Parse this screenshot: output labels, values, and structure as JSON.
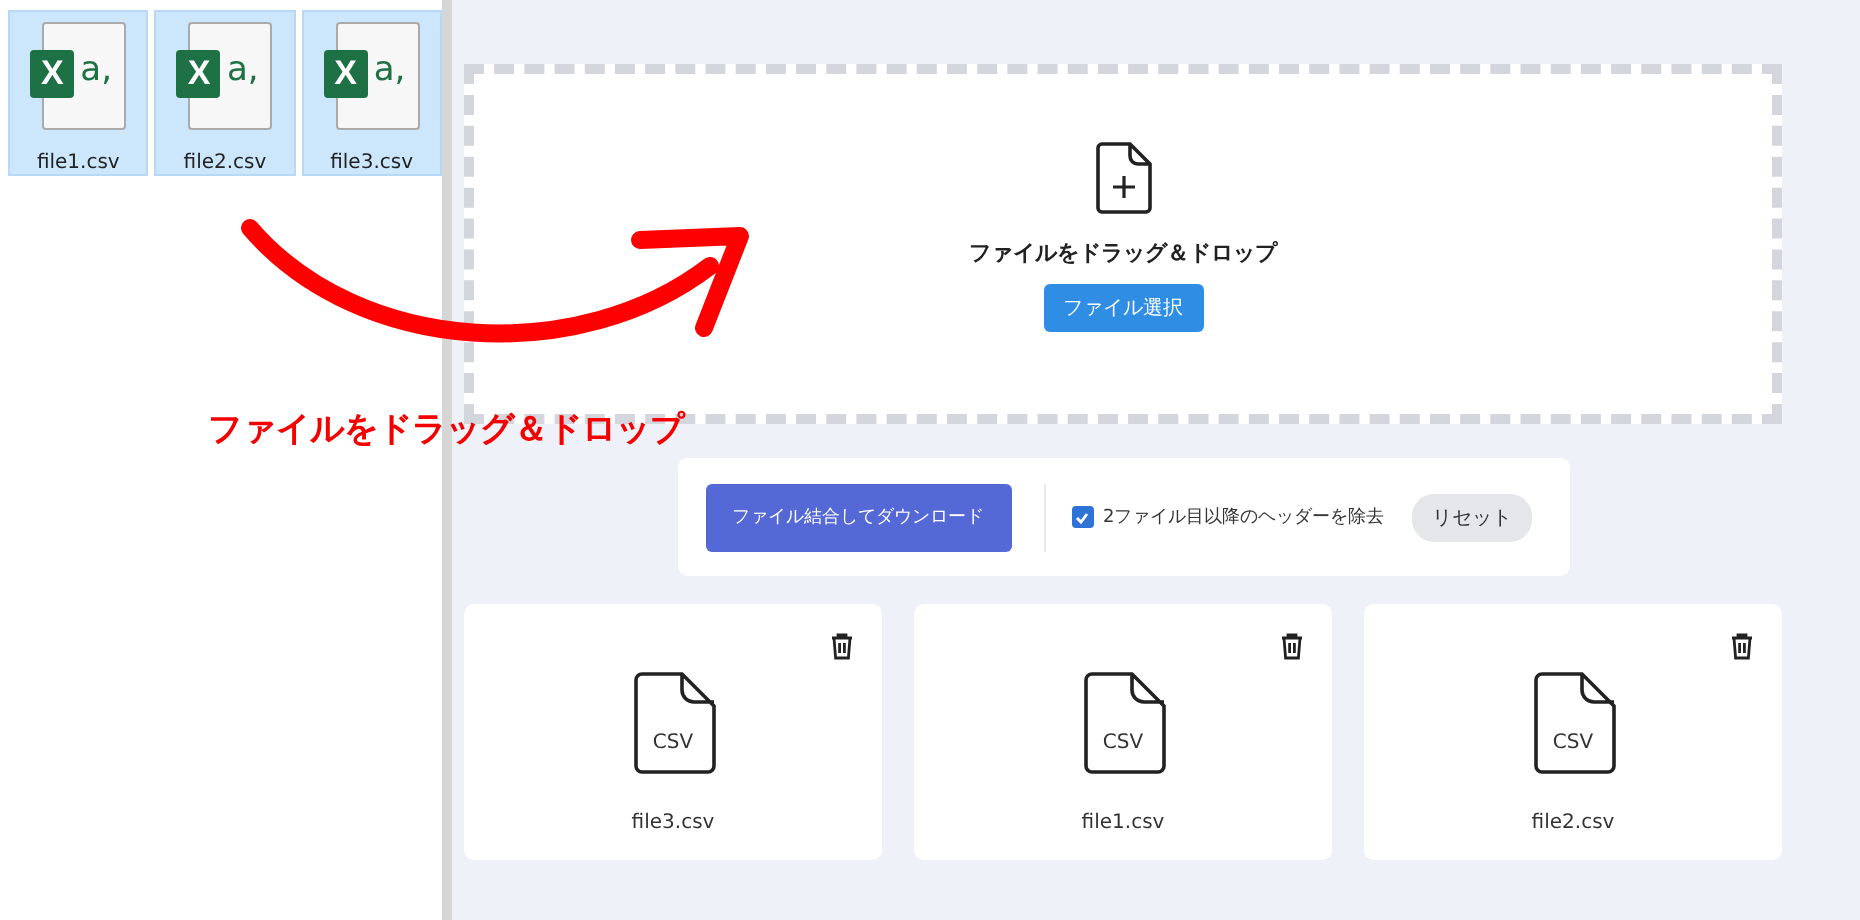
{
  "desktop_files": [
    {
      "name": "file1.csv",
      "icon_letter": "X",
      "icon_mark": "a,",
      "selected": true
    },
    {
      "name": "file2.csv",
      "icon_letter": "X",
      "icon_mark": "a,",
      "selected": true
    },
    {
      "name": "file3.csv",
      "icon_letter": "X",
      "icon_mark": "a,",
      "selected": true
    }
  ],
  "annotation": {
    "text": "ファイルをドラッグ＆ドロップ"
  },
  "drop_zone": {
    "title": "ファイルをドラッグ＆ドロップ",
    "button": "ファイル選択"
  },
  "actions": {
    "merge_button": "ファイル結合してダウンロード",
    "remove_headers": {
      "label": "2ファイル目以降のヘッダーを除去",
      "checked": true
    },
    "reset_button": "リセット"
  },
  "files": [
    {
      "name": "file3.csv",
      "icon_label": "CSV"
    },
    {
      "name": "file1.csv",
      "icon_label": "CSV"
    },
    {
      "name": "file2.csv",
      "icon_label": "CSV"
    }
  ]
}
